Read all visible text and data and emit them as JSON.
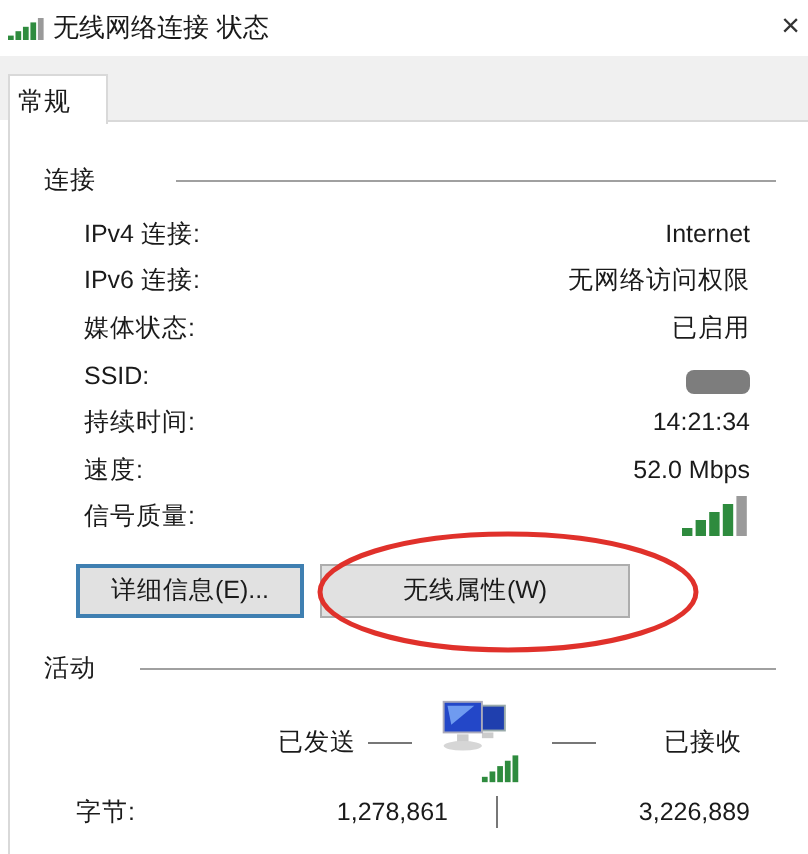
{
  "window": {
    "title": "无线网络连接 状态",
    "close": "×"
  },
  "tabs": [
    {
      "label": "常规",
      "selected": true
    }
  ],
  "connection": {
    "heading": "连接",
    "rows": [
      {
        "kind": "text",
        "label": "IPv4 连接:",
        "value": "Internet"
      },
      {
        "kind": "text",
        "label": "IPv6 连接:",
        "value": "无网络访问权限"
      },
      {
        "kind": "text",
        "label": "媒体状态:",
        "value": "已启用"
      },
      {
        "kind": "redacted",
        "label": "SSID:"
      },
      {
        "kind": "text",
        "label": "持续时间:",
        "value": "14:21:34"
      },
      {
        "kind": "text",
        "label": "速度:",
        "value": "52.0 Mbps"
      },
      {
        "kind": "signal",
        "label": "信号质量:"
      }
    ]
  },
  "buttons": [
    {
      "label": "详细信息(E)...",
      "focused": true
    },
    {
      "label": "无线属性(W)",
      "focused": false,
      "circled": true
    }
  ],
  "activity": {
    "heading": "活动",
    "sent": "已发送",
    "received": "已接收",
    "rows": [
      {
        "label": "字节:",
        "sent": "1,278,861",
        "received": "3,226,889"
      }
    ]
  }
}
